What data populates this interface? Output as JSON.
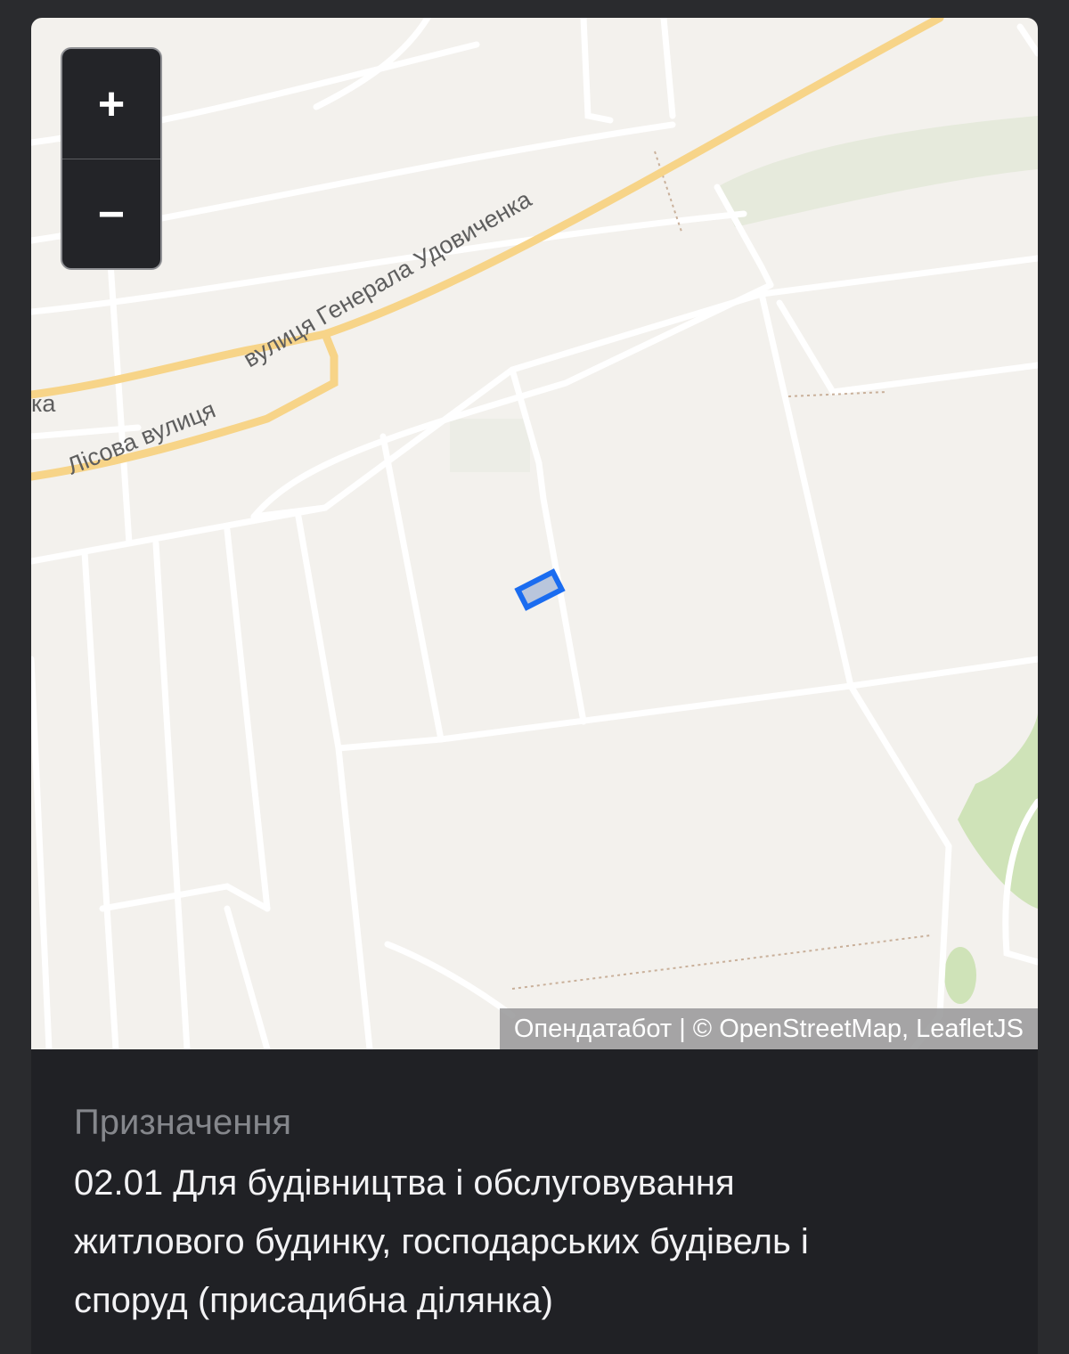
{
  "map": {
    "zoom_in_label": "+",
    "zoom_out_label": "−",
    "attribution": "Опендатабот | © OpenStreetMap, LeafletJS",
    "street_labels": {
      "udovychenka": "вулиця Генерала Удовиченка",
      "lisova": "Лісова вулиця",
      "edge": "ка"
    },
    "colors": {
      "background": "#f3f1ed",
      "road_major": "#f7d488",
      "road_minor": "#ffffff",
      "parcel": "#1a6cf0",
      "vegetation": "#cfe3b8"
    }
  },
  "details": {
    "purpose_label": "Призначення",
    "purpose_lines": [
      "02.01 Для будівництва і обслуговування",
      "житлового будинку, господарських будівель і",
      "споруд (присадибна ділянка)"
    ]
  }
}
